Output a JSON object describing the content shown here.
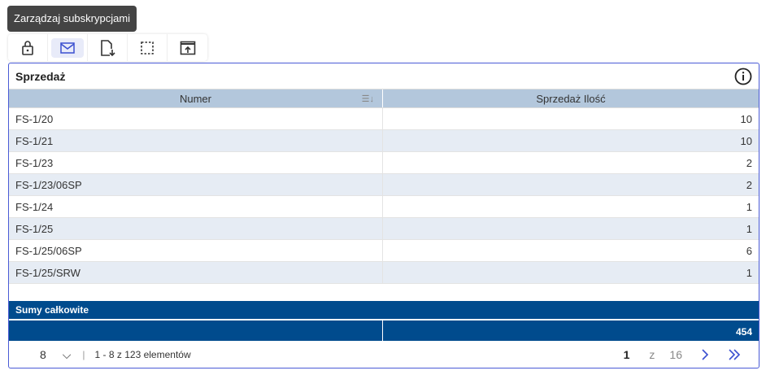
{
  "tooltip": "Zarządzaj subskrypcjami",
  "toolbar": [
    {
      "icon": "lock-icon"
    },
    {
      "icon": "mail-icon",
      "active": true
    },
    {
      "icon": "file-download-icon"
    },
    {
      "icon": "select-area-icon"
    },
    {
      "icon": "open-external-icon"
    }
  ],
  "panel": {
    "title": "Sprzedaż",
    "columns": [
      "Numer",
      "Sprzedaż Ilość"
    ],
    "rows": [
      [
        "FS-1/20",
        "10"
      ],
      [
        "FS-1/21",
        "10"
      ],
      [
        "FS-1/23",
        "2"
      ],
      [
        "FS-1/23/06SP",
        "2"
      ],
      [
        "FS-1/24",
        "1"
      ],
      [
        "FS-1/25",
        "1"
      ],
      [
        "FS-1/25/06SP",
        "6"
      ],
      [
        "FS-1/25/SRW",
        "1"
      ]
    ],
    "totals_label": "Sumy całkowite",
    "totals_value": "454"
  },
  "footer": {
    "page_size": "8",
    "range": "1 - 8 z 123 elementów",
    "current_page": "1",
    "of": "z",
    "total_pages": "16"
  },
  "colors": {
    "accent": "#4a5bd6",
    "header": "#b3c7dc",
    "totals": "#004b8d"
  }
}
